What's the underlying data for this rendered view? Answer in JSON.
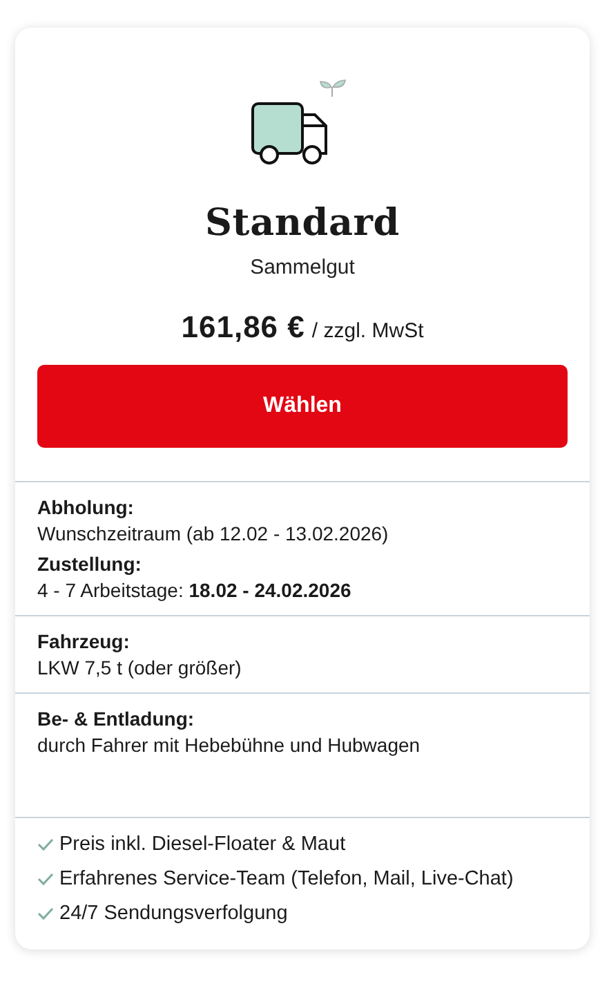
{
  "offer": {
    "title": "Standard",
    "subtitle": "Sammelgut",
    "price": "161,86 €",
    "price_note": "/ zzgl. MwSt",
    "button": "Wählen"
  },
  "details": [
    {
      "items": [
        {
          "label": "Abholung:",
          "value": "Wunschzeitraum (ab 12.02 - 13.02.2026)"
        },
        {
          "label": "Zustellung:",
          "value": "4 - 7 Arbeitstage: **18.02 - 24.02.2026**"
        }
      ]
    },
    {
      "items": [
        {
          "label": "Fahrzeug:",
          "value": "LKW 7,5 t (oder größer)"
        }
      ]
    },
    {
      "items": [
        {
          "label": "Be- & Entladung:",
          "value": "durch Fahrer mit Hebebühne und Hubwagen"
        }
      ]
    }
  ],
  "features": [
    "Preis inkl. Diesel-Floater & Maut",
    "Erfahrenes Service-Team (Telefon, Mail, Live-Chat)",
    "24/7 Sendungsverfolgung"
  ]
}
